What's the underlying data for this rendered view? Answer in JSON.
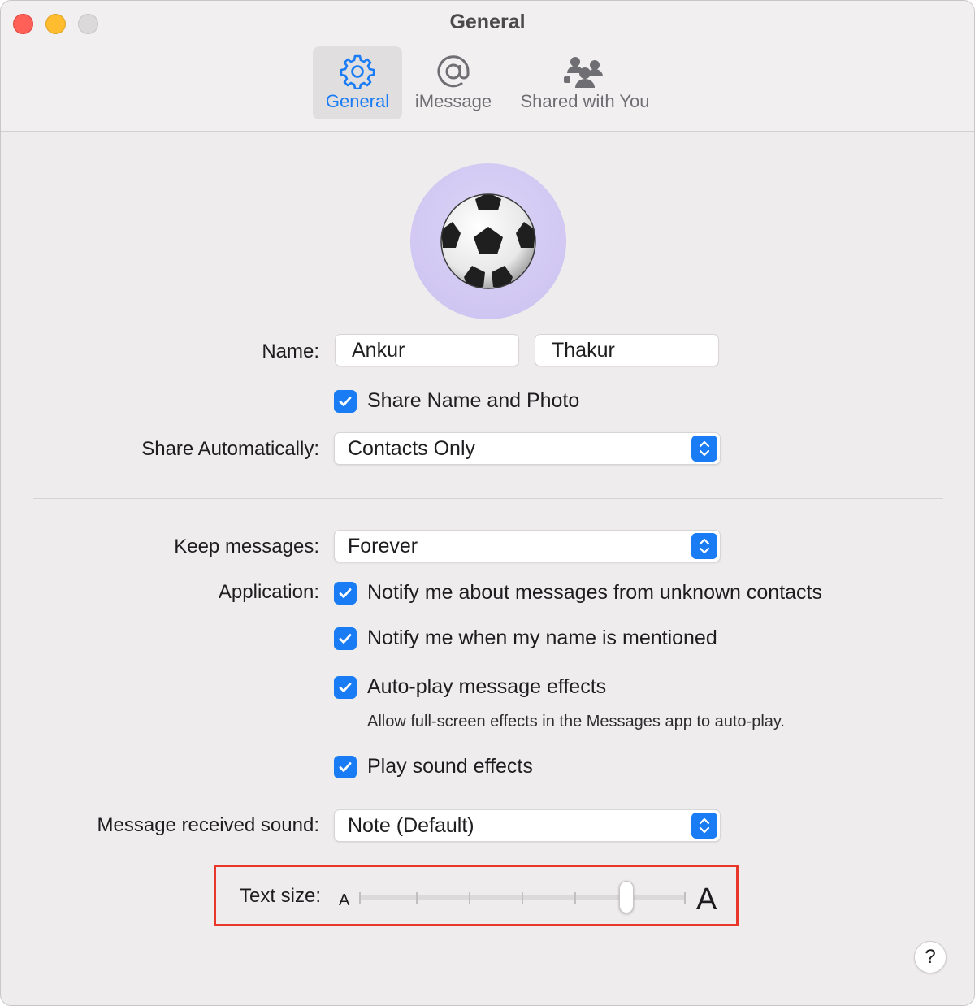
{
  "window": {
    "title": "General"
  },
  "toolbar": {
    "tabs": [
      {
        "label": "General",
        "icon": "gear-icon",
        "active": true
      },
      {
        "label": "iMessage",
        "icon": "at-sign-icon",
        "active": false
      },
      {
        "label": "Shared with You",
        "icon": "people-icon",
        "active": false
      }
    ]
  },
  "profile": {
    "avatar_icon": "soccer-ball-icon"
  },
  "name": {
    "label": "Name:",
    "first": "Ankur",
    "last": "Thakur"
  },
  "share_name": {
    "label": "Share Name and Photo",
    "checked": true
  },
  "share_auto": {
    "label": "Share Automatically:",
    "value": "Contacts Only"
  },
  "keep_messages": {
    "label": "Keep messages:",
    "value": "Forever"
  },
  "application": {
    "label": "Application:",
    "options": [
      {
        "label": "Notify me about messages from unknown contacts",
        "checked": true
      },
      {
        "label": "Notify me when my name is mentioned",
        "checked": true
      },
      {
        "label": "Auto-play message effects",
        "checked": true
      },
      {
        "label": "Play sound effects",
        "checked": true
      }
    ],
    "hint": "Allow full-screen effects in the Messages app to auto-play."
  },
  "received_sound": {
    "label": "Message received sound:",
    "value": "Note (Default)"
  },
  "text_size": {
    "label": "Text size:",
    "small_glyph": "A",
    "large_glyph": "A",
    "level": 5,
    "steps": 7
  },
  "help": {
    "label": "?"
  },
  "colors": {
    "accent": "#1a7cf5",
    "highlight_box": "#e8372a"
  }
}
